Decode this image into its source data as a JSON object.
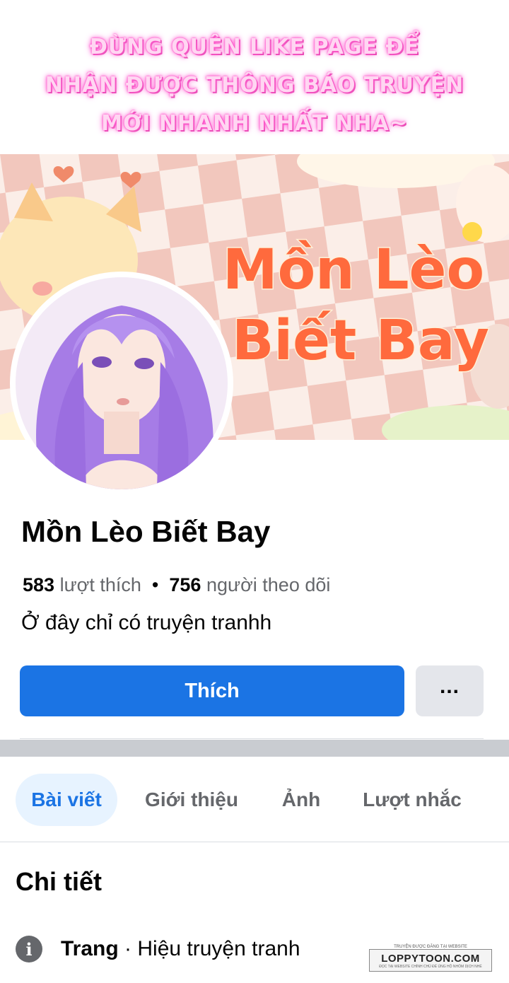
{
  "promo": {
    "line1": "ĐỪNG QUÊN LIKE PAGE ĐỂ",
    "line2": "NHẬN ĐƯỢC THÔNG BÁO TRUYỆN",
    "line3": "MỚI NHANH NHẤT NHA~"
  },
  "cover": {
    "title_line1": "Mồn Lèo",
    "title_line2": "Biết Bay"
  },
  "page": {
    "name": "Mồn Lèo Biết Bay",
    "likes_count": "583",
    "likes_label": "lượt thích",
    "separator": "•",
    "followers_count": "756",
    "followers_label": "người theo dõi",
    "bio": "Ở đây chỉ có truyện tranhh"
  },
  "actions": {
    "like_label": "Thích",
    "more_label": "..."
  },
  "tabs": [
    {
      "label": "Bài viết",
      "active": true
    },
    {
      "label": "Giới thiệu",
      "active": false
    },
    {
      "label": "Ảnh",
      "active": false
    },
    {
      "label": "Lượt nhắc",
      "active": false
    }
  ],
  "details": {
    "title": "Chi tiết",
    "category_key": "Trang",
    "category_sep": "·",
    "category_value": "Hiệu truyện tranh"
  },
  "watermark": {
    "top": "TRUYỆN ĐƯỢC ĐĂNG TẠI WEBSITE",
    "main": "LOPPYTOON.COM",
    "sub": "ĐỌC TẠI WEBSITE CHÍNH CHỦ ĐỂ ỦNG HỘ NHÓM DỊCH NHÉ"
  },
  "colors": {
    "primary_blue": "#1b74e4",
    "tab_active_bg": "#e7f3ff",
    "secondary_btn": "#e4e6eb",
    "muted_text": "#65676b",
    "promo_glow": "#ff5bd0"
  }
}
